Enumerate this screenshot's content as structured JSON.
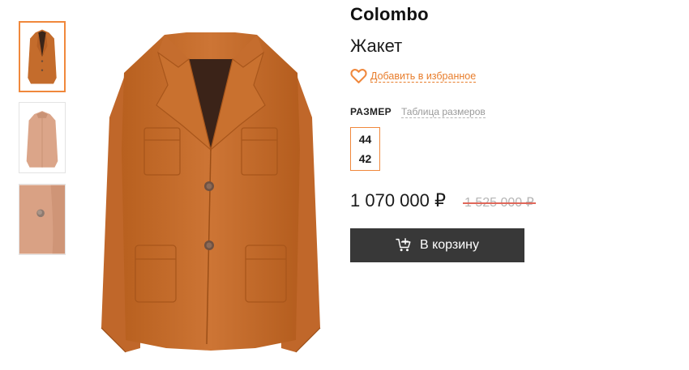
{
  "product": {
    "brand": "Colombo",
    "name": "Жакет",
    "favorite_label": "Добавить в избранное",
    "color": "#c46c2c"
  },
  "size": {
    "heading": "РАЗМЕР",
    "table_link": "Таблица размеров",
    "options": [
      "44",
      "42"
    ]
  },
  "price": {
    "current": "1 070 000 ₽",
    "old": "1 525 000 ₽"
  },
  "cart": {
    "label": "В корзину",
    "icon": "cart-plus-icon"
  },
  "gallery": {
    "thumbnails": [
      "jacket-front",
      "jacket-back",
      "button-closeup"
    ],
    "active_index": 0
  },
  "colors": {
    "accent": "#f0883c",
    "link": "#e87d2b",
    "button": "#383838",
    "strike": "#e0675a"
  }
}
